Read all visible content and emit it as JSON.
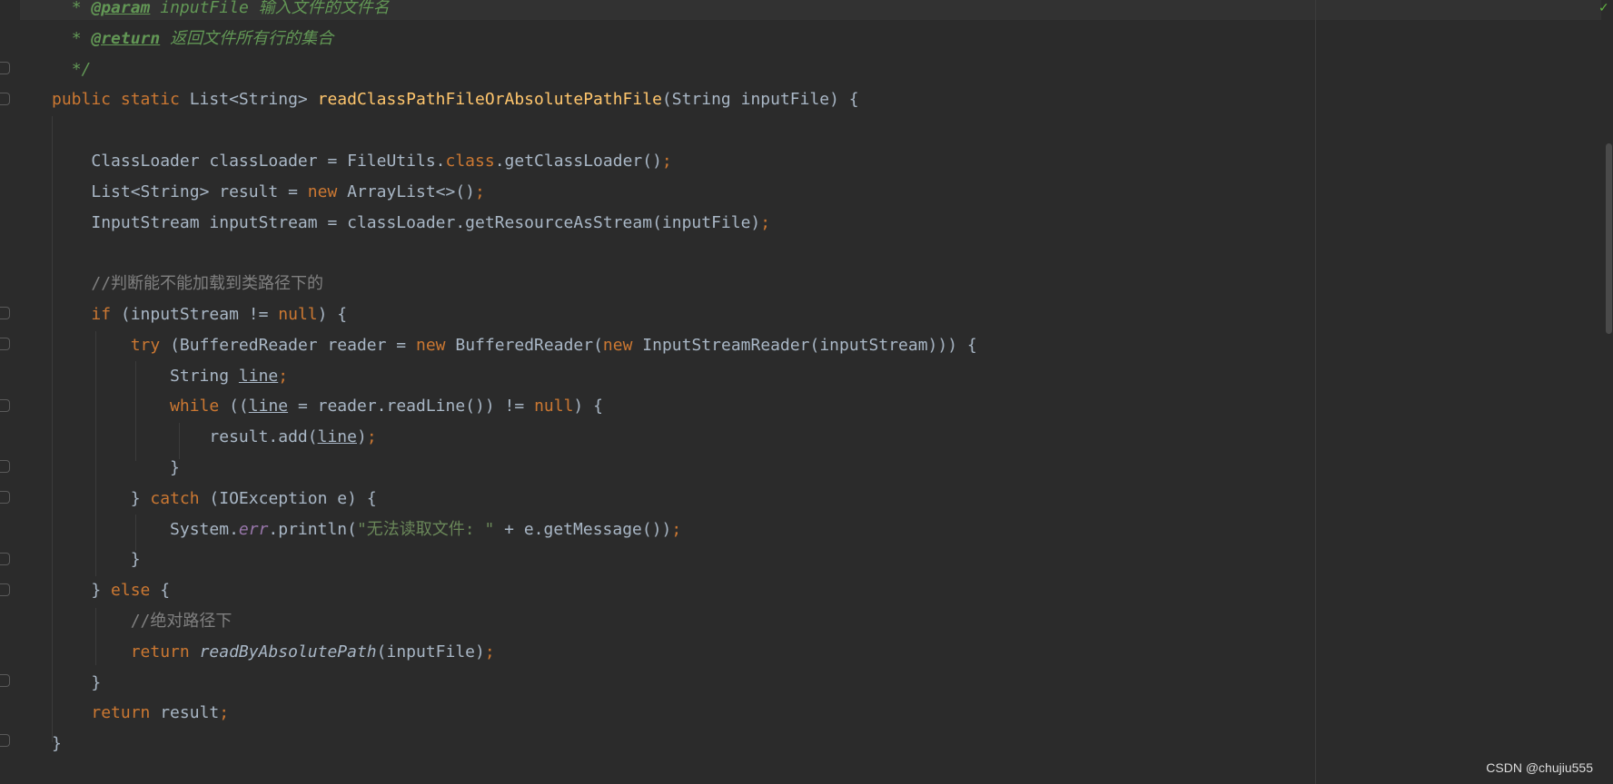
{
  "lines": [
    {
      "indent": "  ",
      "segs": [
        {
          "t": "* ",
          "c": "cm"
        },
        {
          "t": "@param",
          "c": "tag"
        },
        {
          "t": " inputFile 输入文件的文件名",
          "c": "cm"
        }
      ]
    },
    {
      "indent": "  ",
      "segs": [
        {
          "t": "* ",
          "c": "cm"
        },
        {
          "t": "@return",
          "c": "tag"
        },
        {
          "t": " 返回文件所有行的集合",
          "c": "cm"
        }
      ]
    },
    {
      "indent": "  ",
      "segs": [
        {
          "t": "*/",
          "c": "cm"
        }
      ]
    },
    {
      "indent": "",
      "segs": [
        {
          "t": "public static ",
          "c": "kw"
        },
        {
          "t": "List<String> ",
          "c": ""
        },
        {
          "t": "readClassPathFileOrAbsolutePathFile",
          "c": "fn"
        },
        {
          "t": "(String inputFile) {",
          "c": ""
        }
      ]
    },
    {
      "indent": "",
      "segs": []
    },
    {
      "indent": "    ",
      "segs": [
        {
          "t": "ClassLoader classLoader = FileUtils.",
          "c": ""
        },
        {
          "t": "class",
          "c": "kw"
        },
        {
          "t": ".getClassLoader()",
          "c": ""
        },
        {
          "t": ";",
          "c": "semi"
        }
      ]
    },
    {
      "indent": "    ",
      "segs": [
        {
          "t": "List<String> result = ",
          "c": ""
        },
        {
          "t": "new ",
          "c": "kw"
        },
        {
          "t": "ArrayList<>()",
          "c": ""
        },
        {
          "t": ";",
          "c": "semi"
        }
      ]
    },
    {
      "indent": "    ",
      "segs": [
        {
          "t": "InputStream inputStream = classLoader.getResourceAsStream(inputFile)",
          "c": ""
        },
        {
          "t": ";",
          "c": "semi"
        }
      ]
    },
    {
      "indent": "",
      "segs": []
    },
    {
      "indent": "    ",
      "segs": [
        {
          "t": "//判断能不能加载到类路径下的",
          "c": "lc"
        }
      ]
    },
    {
      "indent": "    ",
      "segs": [
        {
          "t": "if ",
          "c": "kw"
        },
        {
          "t": "(inputStream != ",
          "c": ""
        },
        {
          "t": "null",
          "c": "kw"
        },
        {
          "t": ") {",
          "c": ""
        }
      ]
    },
    {
      "indent": "        ",
      "segs": [
        {
          "t": "try ",
          "c": "kw"
        },
        {
          "t": "(BufferedReader reader = ",
          "c": ""
        },
        {
          "t": "new ",
          "c": "kw"
        },
        {
          "t": "BufferedReader(",
          "c": ""
        },
        {
          "t": "new ",
          "c": "kw"
        },
        {
          "t": "InputStreamReader(inputStream))) {",
          "c": ""
        }
      ]
    },
    {
      "indent": "            ",
      "segs": [
        {
          "t": "String ",
          "c": ""
        },
        {
          "t": "line",
          "c": "ul"
        },
        {
          "t": ";",
          "c": "semi"
        }
      ]
    },
    {
      "indent": "            ",
      "segs": [
        {
          "t": "while ",
          "c": "kw"
        },
        {
          "t": "((",
          "c": ""
        },
        {
          "t": "line",
          "c": "ul"
        },
        {
          "t": " = reader.readLine()) != ",
          "c": ""
        },
        {
          "t": "null",
          "c": "kw"
        },
        {
          "t": ") {",
          "c": ""
        }
      ]
    },
    {
      "indent": "                ",
      "segs": [
        {
          "t": "result.add(",
          "c": ""
        },
        {
          "t": "line",
          "c": "ul"
        },
        {
          "t": ")",
          "c": ""
        },
        {
          "t": ";",
          "c": "semi"
        }
      ]
    },
    {
      "indent": "            ",
      "segs": [
        {
          "t": "}",
          "c": ""
        }
      ]
    },
    {
      "indent": "        ",
      "segs": [
        {
          "t": "} ",
          "c": ""
        },
        {
          "t": "catch ",
          "c": "kw"
        },
        {
          "t": "(IOException e) {",
          "c": ""
        }
      ]
    },
    {
      "indent": "            ",
      "segs": [
        {
          "t": "System.",
          "c": ""
        },
        {
          "t": "err",
          "c": "fld"
        },
        {
          "t": ".println(",
          "c": ""
        },
        {
          "t": "\"无法读取文件: \"",
          "c": "str"
        },
        {
          "t": " + e.getMessage())",
          "c": ""
        },
        {
          "t": ";",
          "c": "semi"
        }
      ]
    },
    {
      "indent": "        ",
      "segs": [
        {
          "t": "}",
          "c": ""
        }
      ]
    },
    {
      "indent": "    ",
      "segs": [
        {
          "t": "} ",
          "c": ""
        },
        {
          "t": "else ",
          "c": "kw"
        },
        {
          "t": "{",
          "c": ""
        }
      ]
    },
    {
      "indent": "        ",
      "segs": [
        {
          "t": "//绝对路径下",
          "c": "lc"
        }
      ]
    },
    {
      "indent": "        ",
      "segs": [
        {
          "t": "return ",
          "c": "kw"
        },
        {
          "t": "readByAbsolutePath",
          "c": "st"
        },
        {
          "t": "(inputFile)",
          "c": ""
        },
        {
          "t": ";",
          "c": "semi"
        }
      ]
    },
    {
      "indent": "    ",
      "segs": [
        {
          "t": "}",
          "c": ""
        }
      ]
    },
    {
      "indent": "    ",
      "segs": [
        {
          "t": "return ",
          "c": "kw"
        },
        {
          "t": "result",
          "c": ""
        },
        {
          "t": ";",
          "c": "semi"
        }
      ]
    },
    {
      "indent": "",
      "segs": [
        {
          "t": "}",
          "c": ""
        }
      ]
    }
  ],
  "watermark": "CSDN @chujiu555",
  "colors": {
    "background": "#2b2b2b",
    "keyword": "#cc7832",
    "method": "#ffc66d",
    "doc_comment": "#629755",
    "line_comment": "#808080",
    "string": "#6a8759",
    "field": "#9876aa",
    "text": "#a9b7c6"
  }
}
